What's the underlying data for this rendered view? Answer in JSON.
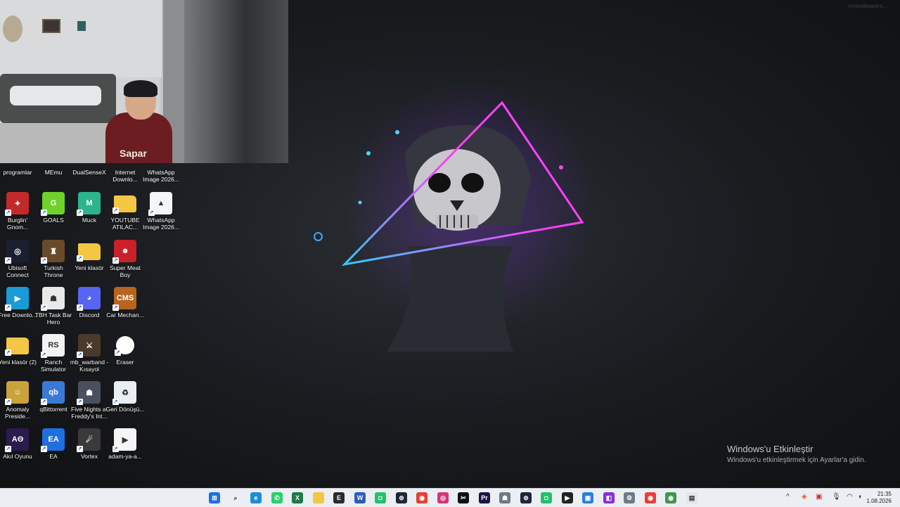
{
  "desktop": {
    "activation_title": "Windows'u Etkinleştir",
    "activation_subtitle": "Windows'u etkinleştirmek için Ayarlar'a gidin.",
    "watermark": "mywallpapers..."
  },
  "webcam": {
    "shirt_text": "Sapar"
  },
  "top_row_labels": [
    "programlar",
    "MEmu",
    "DualSenseX",
    "Internet Downlo...",
    "WhatsApp Image 2026..."
  ],
  "icons": [
    {
      "label": "Burglin' Gnom...",
      "icon": "gnome-app-icon",
      "bg": "#c22a2a",
      "glyph": "✦"
    },
    {
      "label": "GOALS",
      "icon": "goals-app-icon",
      "bg": "#6fd12b",
      "glyph": "G"
    },
    {
      "label": "Muck",
      "icon": "muck-app-icon",
      "bg": "#2bb58f",
      "glyph": "M"
    },
    {
      "label": "YOUTUBE ATILAC...",
      "icon": "folder-icon",
      "bg": "#f3c744",
      "glyph": ""
    },
    {
      "label": "WhatsApp Image 2026...",
      "icon": "image-file-icon",
      "bg": "#f3f5f8",
      "glyph": "▲"
    },
    {
      "label": "Ubisoft Connect",
      "icon": "ubisoft-icon",
      "bg": "#1b1f2e",
      "glyph": "◎"
    },
    {
      "label": "Turkish Throne",
      "icon": "turkish-throne-icon",
      "bg": "#6a4a2a",
      "glyph": "♜"
    },
    {
      "label": "Yeni klasör",
      "icon": "folder-icon",
      "bg": "#f3c744",
      "glyph": ""
    },
    {
      "label": "Super Meat Boy",
      "icon": "super-meat-boy-icon",
      "bg": "#c9202a",
      "glyph": "☻"
    },
    {
      "label": "Free Downlo...",
      "icon": "free-download-icon",
      "bg": "#1a9ad6",
      "glyph": "▶"
    },
    {
      "label": "TBH Task Bar Hero",
      "icon": "tbh-icon",
      "bg": "#e9e9e9",
      "glyph": "☗"
    },
    {
      "label": "Discord",
      "icon": "discord-icon",
      "bg": "#5865f2",
      "glyph": "◕"
    },
    {
      "label": "Car Mechan...",
      "icon": "car-mechanic-icon",
      "bg": "#b8641c",
      "glyph": "CMS"
    },
    {
      "label": "Yeni klasör (2)",
      "icon": "folder-icon",
      "bg": "#f3c744",
      "glyph": ""
    },
    {
      "label": "Ranch Simulator",
      "icon": "ranch-simulator-icon",
      "bg": "#f2f2f2",
      "glyph": "RS"
    },
    {
      "label": "mb_warband - Kısayol",
      "icon": "warband-icon",
      "bg": "#4a3a2c",
      "glyph": "⚔"
    },
    {
      "label": "Eraser",
      "icon": "eraser-icon",
      "bg": "#ffffff",
      "glyph": ""
    },
    {
      "label": "Anomaly Preside...",
      "icon": "anomaly-icon",
      "bg": "#c9a23a",
      "glyph": "☺"
    },
    {
      "label": "qBittorrent",
      "icon": "qbittorrent-icon",
      "bg": "#3a7ad6",
      "glyph": "qb"
    },
    {
      "label": "Five Nights at Freddy's Int...",
      "icon": "fnaf-icon",
      "bg": "#4a5060",
      "glyph": "☗"
    },
    {
      "label": "Geri Dönüşü...",
      "icon": "recycle-bin-icon",
      "bg": "#e8eef4",
      "glyph": "♻"
    },
    {
      "label": "Akıl Oyunu",
      "icon": "akil-oyunu-icon",
      "bg": "#2b1b4e",
      "glyph": "AΘ"
    },
    {
      "label": "EA",
      "icon": "ea-icon",
      "bg": "#1f6fe0",
      "glyph": "EA"
    },
    {
      "label": "Vortex",
      "icon": "vortex-icon",
      "bg": "#3a3a3a",
      "glyph": "☄"
    },
    {
      "label": "adam-ya-a...",
      "icon": "video-file-icon",
      "bg": "#f5f5f5",
      "glyph": "▶"
    }
  ],
  "taskbar": {
    "apps": [
      {
        "icon": "start-icon",
        "bg": "#1f6fe0",
        "glyph": "⊞"
      },
      {
        "icon": "search-icon",
        "bg": "transparent",
        "glyph": "⌕"
      },
      {
        "icon": "edge-icon",
        "bg": "#1b8fd6",
        "glyph": "e"
      },
      {
        "icon": "whatsapp-icon",
        "bg": "#25d366",
        "glyph": "✆"
      },
      {
        "icon": "excel-icon",
        "bg": "#1d7a44",
        "glyph": "X"
      },
      {
        "icon": "file-explorer-icon",
        "bg": "#f3c744",
        "glyph": ""
      },
      {
        "icon": "epic-games-icon",
        "bg": "#2a2a2a",
        "glyph": "E"
      },
      {
        "icon": "word-icon",
        "bg": "#2b5eb7",
        "glyph": "W"
      },
      {
        "icon": "android-icon",
        "bg": "#27c06a",
        "glyph": "◘"
      },
      {
        "icon": "steam-icon",
        "bg": "#1b2838",
        "glyph": "⊚"
      },
      {
        "icon": "chrome-icon",
        "bg": "#e44134",
        "glyph": "◉"
      },
      {
        "icon": "instagram-icon",
        "bg": "#d2367a",
        "glyph": "◎"
      },
      {
        "icon": "capcut-icon",
        "bg": "#111111",
        "glyph": "✂"
      },
      {
        "icon": "premiere-icon",
        "bg": "#1e1247",
        "glyph": "Pr"
      },
      {
        "icon": "app-icon",
        "bg": "#6c7a8a",
        "glyph": "☗"
      },
      {
        "icon": "steam-icon",
        "bg": "#1b2838",
        "glyph": "⊚"
      },
      {
        "icon": "android-icon",
        "bg": "#27c06a",
        "glyph": "◘"
      },
      {
        "icon": "media-player-icon",
        "bg": "#222222",
        "glyph": "▶"
      },
      {
        "icon": "store-icon",
        "bg": "#2a7fd6",
        "glyph": "▣"
      },
      {
        "icon": "twitch-icon",
        "bg": "#8c2cd6",
        "glyph": "◧"
      },
      {
        "icon": "settings-icon",
        "bg": "#6c7a8a",
        "glyph": "⚙"
      },
      {
        "icon": "chrome-icon",
        "bg": "#e44134",
        "glyph": "◉"
      },
      {
        "icon": "chrome-icon",
        "bg": "#3a9a4a",
        "glyph": "◉"
      },
      {
        "icon": "notepad-icon",
        "bg": "#dfe6ee",
        "glyph": "▤"
      }
    ],
    "time": "21:35",
    "date": "1.08.2026"
  }
}
